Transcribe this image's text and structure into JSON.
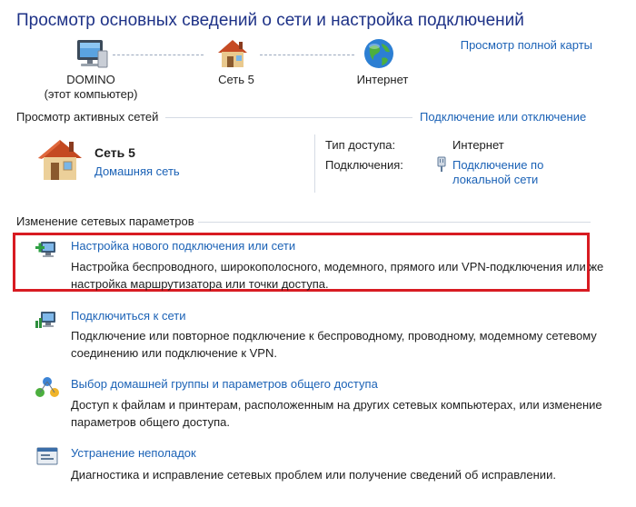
{
  "header": {
    "title": "Просмотр основных сведений о сети и настройка подключений",
    "full_map_link": "Просмотр полной карты"
  },
  "network_map": {
    "computer_name": "DOMINO",
    "computer_note": "(этот компьютер)",
    "network_name": "Сеть  5",
    "internet": "Интернет"
  },
  "active_networks": {
    "section_title": "Просмотр активных сетей",
    "connect_disconnect_link": "Подключение или отключение",
    "network_name": "Сеть  5",
    "network_type": "Домашняя сеть",
    "access_type_label": "Тип доступа:",
    "access_type_value": "Интернет",
    "connections_label": "Подключения:",
    "connection_line1": "Подключение по",
    "connection_line2": "локальной сети"
  },
  "change_settings": {
    "section_title": "Изменение сетевых параметров",
    "tasks": [
      {
        "icon": "new-connection-icon",
        "link": "Настройка нового подключения или сети",
        "description": "Настройка беспроводного, широкополосного, модемного, прямого или VPN-подключения или же настройка маршрутизатора или точки доступа."
      },
      {
        "icon": "connect-network-icon",
        "link": "Подключиться к сети",
        "description": "Подключение или повторное подключение к беспроводному, проводному, модемному сетевому соединению или подключение к VPN."
      },
      {
        "icon": "homegroup-icon",
        "link": "Выбор домашней группы и параметров общего доступа",
        "description": "Доступ к файлам и принтерам, расположенным на других сетевых компьютерах, или изменение параметров общего доступа."
      },
      {
        "icon": "troubleshoot-icon",
        "link": "Устранение неполадок",
        "description": "Диагностика и исправление сетевых проблем или получение сведений об исправлении."
      }
    ]
  },
  "colors": {
    "link": "#1b62b6",
    "title": "#1e3287",
    "highlight_border": "#d81b22"
  }
}
